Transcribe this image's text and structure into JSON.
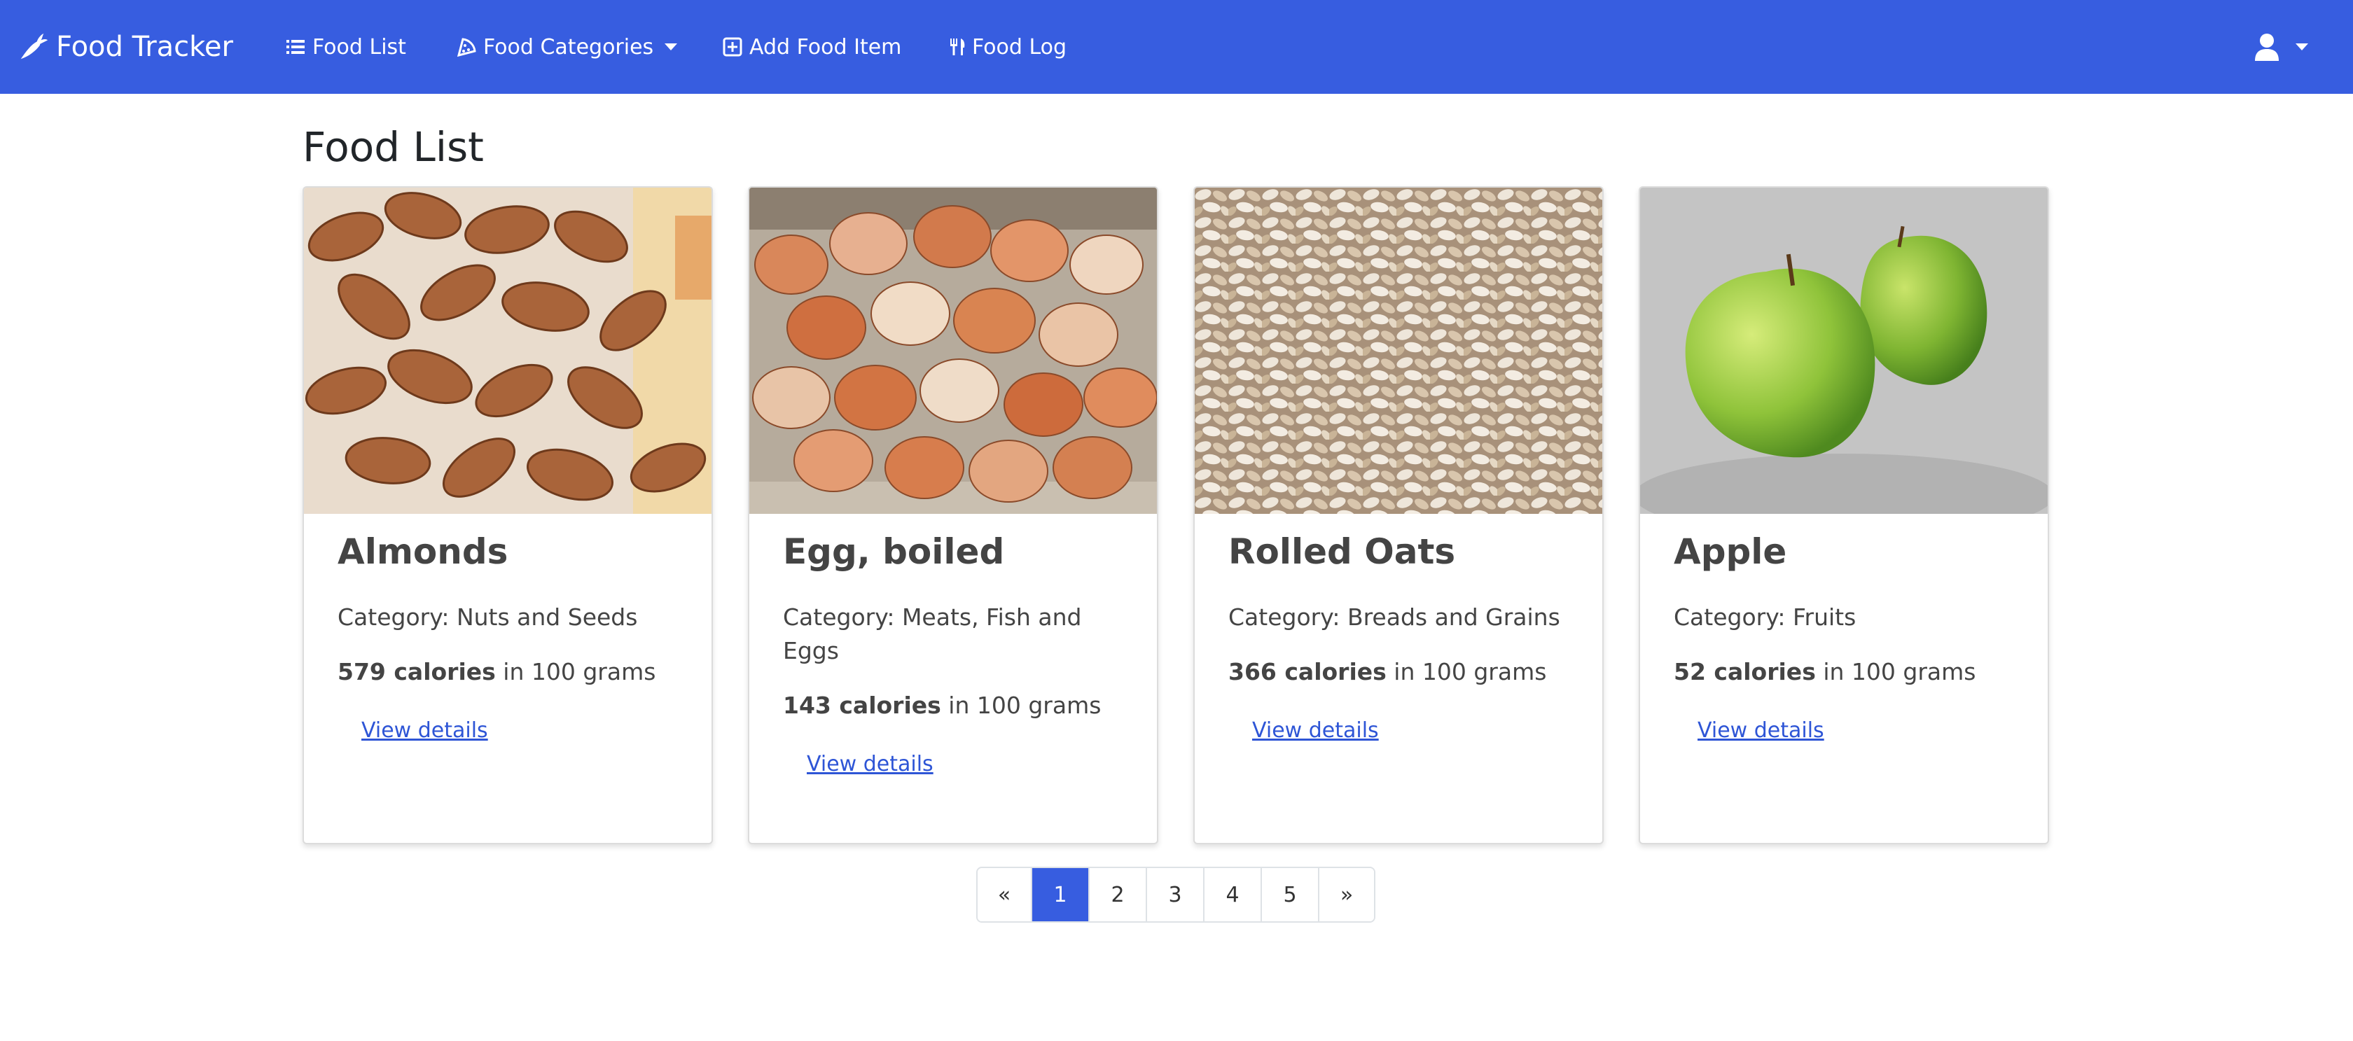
{
  "navbar": {
    "brand": "Food Tracker",
    "links": [
      {
        "label": "Food List",
        "icon": "list-icon"
      },
      {
        "label": "Food Categories",
        "icon": "pizza-slice-icon",
        "dropdown": true
      },
      {
        "label": "Add Food Item",
        "icon": "plus-square-icon"
      },
      {
        "label": "Food Log",
        "icon": "utensils-icon"
      }
    ],
    "user_icon": "user-icon"
  },
  "main": {
    "title": "Food List",
    "cards": [
      {
        "name": "Almonds",
        "category": "Category: Nuts and Seeds",
        "calories": "579 calories",
        "unit_text": " in 100 grams",
        "link": "View details",
        "image": "almonds-photo"
      },
      {
        "name": "Egg, boiled",
        "category": "Category: Meats, Fish and Eggs",
        "calories": "143 calories",
        "unit_text": " in 100 grams",
        "link": "View details",
        "image": "eggs-photo"
      },
      {
        "name": "Rolled Oats",
        "category": "Category: Breads and Grains",
        "calories": "366 calories",
        "unit_text": " in 100 grams",
        "link": "View details",
        "image": "oats-photo"
      },
      {
        "name": "Apple",
        "category": "Category: Fruits",
        "calories": "52 calories",
        "unit_text": " in 100 grams",
        "link": "View details",
        "image": "apple-photo"
      }
    ]
  },
  "pagination": {
    "prev": "«",
    "pages": [
      "1",
      "2",
      "3",
      "4",
      "5"
    ],
    "next": "»",
    "active_page": "1"
  },
  "colors": {
    "navbar": "#375de0",
    "link": "#2e55d6",
    "active_page": "#375de0"
  }
}
